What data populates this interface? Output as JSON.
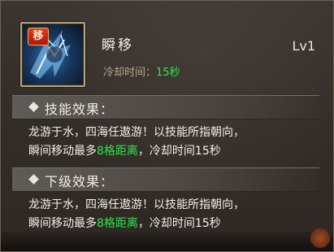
{
  "skill": {
    "tag": "移",
    "name": "瞬移",
    "level": "Lv1",
    "cooldown_label": "冷却时间：",
    "cooldown_value": "15秒"
  },
  "current_effect": {
    "title": "技能效果：",
    "line1": "龙游于水，四海任遨游！以技能所指朝向，",
    "line2_pre": "瞬间移动最多",
    "line2_highlight": "8格距离",
    "line2_post": "，冷却时间15秒"
  },
  "next_effect": {
    "title": "下级效果：",
    "line1": "龙游于水，四海任遨游！以技能所指朝向，",
    "line2_pre": "瞬间移动最多",
    "line2_highlight": "8格距离",
    "line2_post": "，冷却时间15秒"
  },
  "colors": {
    "highlight": "#2be64a",
    "text": "#f3eee4",
    "tag_bg": "#c22a16"
  },
  "icons": [
    "skill-teleport-icon",
    "diamond-icon",
    "bottom-emblem-icon"
  ]
}
